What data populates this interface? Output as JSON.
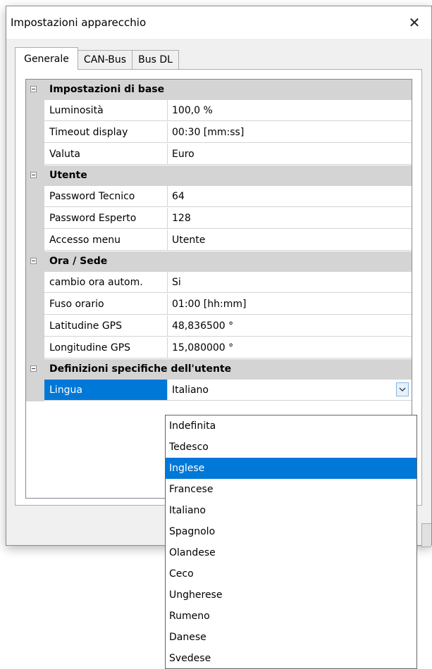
{
  "window": {
    "title": "Impostazioni apparecchio",
    "close_label": "✕"
  },
  "tabs": [
    {
      "label": "Generale",
      "active": true
    },
    {
      "label": "CAN-Bus",
      "active": false
    },
    {
      "label": "Bus DL",
      "active": false
    }
  ],
  "categories": [
    {
      "label": "Impostazioni di base",
      "rows": [
        {
          "name": "Luminosità",
          "value": "100,0 %"
        },
        {
          "name": "Timeout display",
          "value": "00:30 [mm:ss]"
        },
        {
          "name": "Valuta",
          "value": "Euro"
        }
      ]
    },
    {
      "label": "Utente",
      "rows": [
        {
          "name": "Password Tecnico",
          "value": "64"
        },
        {
          "name": "Password Esperto",
          "value": "128"
        },
        {
          "name": "Accesso menu",
          "value": "Utente"
        }
      ]
    },
    {
      "label": "Ora / Sede",
      "rows": [
        {
          "name": "cambio ora autom.",
          "value": "Si"
        },
        {
          "name": "Fuso orario",
          "value": "01:00 [hh:mm]"
        },
        {
          "name": "Latitudine GPS",
          "value": "48,836500 °"
        },
        {
          "name": "Longitudine GPS",
          "value": "15,080000 °"
        }
      ]
    },
    {
      "label": "Definizioni specifiche dell'utente",
      "rows": [
        {
          "name": "Lingua",
          "value": "Italiano",
          "selected": true,
          "combo": true
        }
      ]
    }
  ],
  "dropdown": {
    "highlighted": "Inglese",
    "options": [
      "Indefinita",
      "Tedesco",
      "Inglese",
      "Francese",
      "Italiano",
      "Spagnolo",
      "Olandese",
      "Ceco",
      "Ungherese",
      "Rumeno",
      "Danese",
      "Svedese"
    ]
  },
  "colors": {
    "selection": "#0078d7",
    "category_bg": "#d4d4d4",
    "window_bg": "#f0f0f0"
  },
  "icons": {
    "close": "close-icon",
    "toggle": "collapse-icon",
    "combo": "chevron-down-icon"
  }
}
